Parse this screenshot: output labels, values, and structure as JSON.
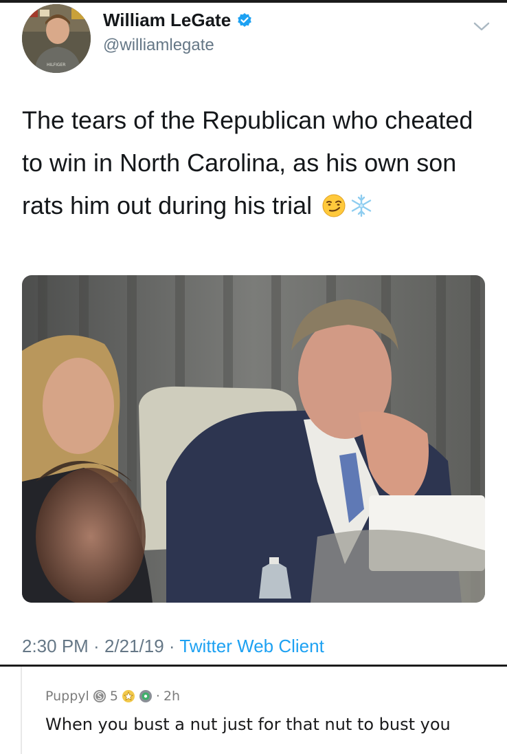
{
  "tweet": {
    "author": {
      "display_name": "William LeGate",
      "handle": "@williamlegate",
      "verified_icon": "verified-badge-icon",
      "avatar": "profile-avatar-photo",
      "avatar_shirt_text": "HILFIGER"
    },
    "menu_icon": "chevron-down-icon",
    "text": "The tears of the Republican who cheated to win in North Carolina, as his own son rats him out during his trial",
    "emojis": [
      "smirking-face-emoji",
      "snowflake-emoji"
    ],
    "media": {
      "description_icon": "photo-man-crying-in-courtroom"
    },
    "timestamp": {
      "time": "2:30 PM",
      "separator1": " · ",
      "date": "2/21/19",
      "separator2": " · ",
      "source": "Twitter Web Client"
    },
    "colors": {
      "text": "#14171a",
      "muted": "#657786",
      "link": "#1da1f2",
      "verified": "#1da1f2"
    }
  },
  "comment": {
    "username": "Puppyl",
    "karma": "5",
    "badges": [
      "s-coin-badge-icon",
      "award-badge-icon",
      "green-badge-icon"
    ],
    "separator": "·",
    "age": "2h",
    "body": "When you bust a nut just for that nut to bust you"
  }
}
